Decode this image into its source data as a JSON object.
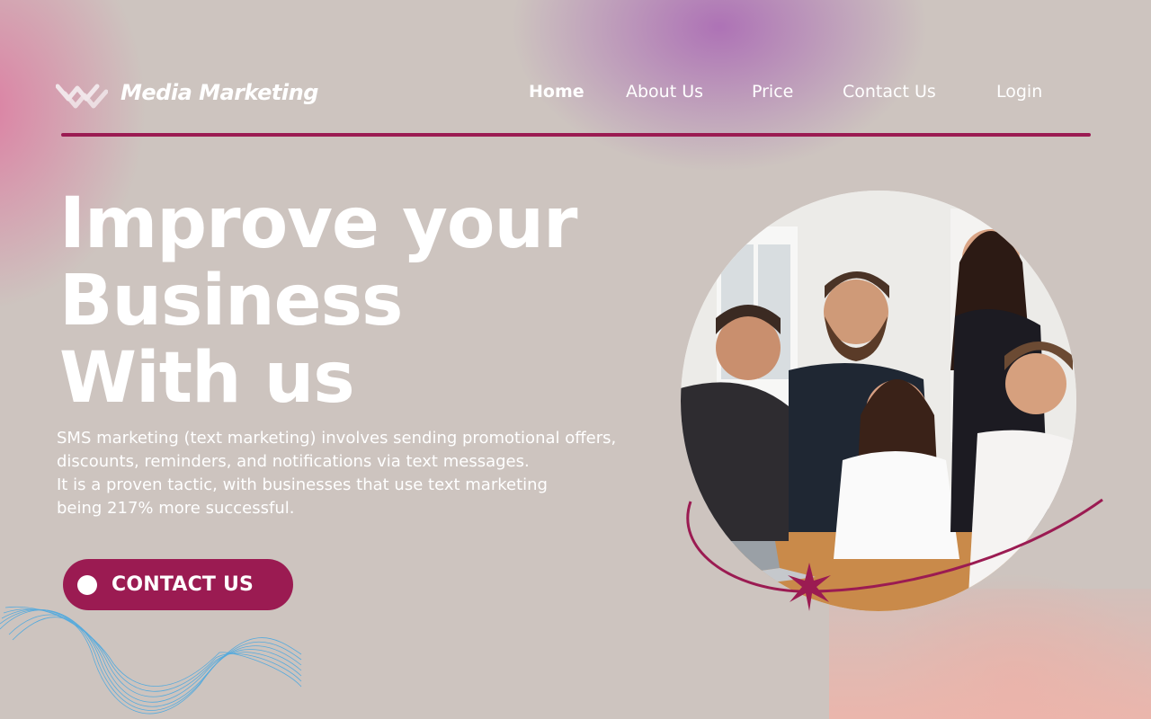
{
  "brand": {
    "name": "Media Marketing",
    "logo_icon": "double-chevron-logo-icon"
  },
  "nav": {
    "items": [
      {
        "label": "Home",
        "active": true
      },
      {
        "label": "About Us",
        "active": false
      },
      {
        "label": "Price",
        "active": false
      },
      {
        "label": "Contact Us",
        "active": false
      }
    ],
    "login_label": "Login"
  },
  "hero": {
    "title_lines": [
      "Improve your",
      "Business",
      "With us"
    ],
    "description_lines": [
      "SMS marketing (text marketing) involves sending promotional offers,",
      "discounts, reminders, and notifications via text messages.",
      "It is a proven tactic, with businesses that use text marketing",
      "being 217% more successful."
    ],
    "cta_label": "CONTACT US"
  },
  "colors": {
    "accent": "#9b1b52",
    "background": "#cdc4bf",
    "text": "#ffffff",
    "wave": "#4aa8e0"
  }
}
